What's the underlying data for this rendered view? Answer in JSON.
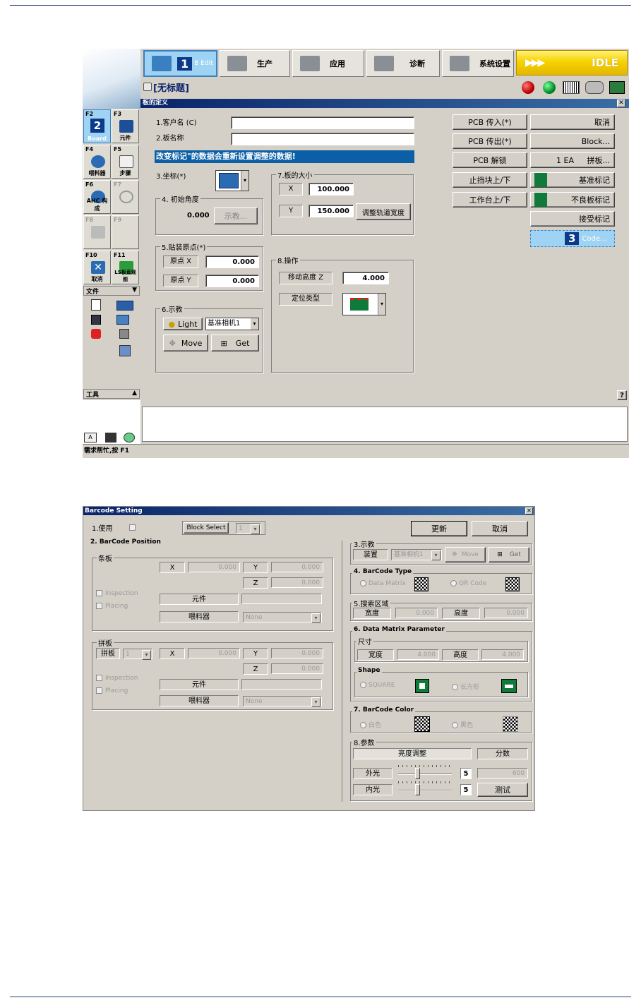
{
  "win1": {
    "toolbar": {
      "bedit_num": "1",
      "bedit_label": "B Edit",
      "items": [
        {
          "label": "生产"
        },
        {
          "label": "应用"
        },
        {
          "label": "诊断"
        },
        {
          "label": "系统设置"
        }
      ],
      "idle_arrows": "▶▶▶",
      "idle_label": "IDLE"
    },
    "doc_title": "[无标题]",
    "status_icons": [
      "red-lamp",
      "green-lamp",
      "barcode",
      "camera",
      "board"
    ],
    "fkeys": [
      {
        "key": "F2",
        "num": "2",
        "label": "Board"
      },
      {
        "key": "F3",
        "label": "元件"
      },
      {
        "key": "F4",
        "label": "喂料器"
      },
      {
        "key": "F5",
        "label": "步骤"
      },
      {
        "key": "F6",
        "label": "AHC 构成"
      },
      {
        "key": "F7",
        "label": ""
      },
      {
        "key": "F8",
        "label": ""
      },
      {
        "key": "F9",
        "label": ""
      },
      {
        "key": "F10",
        "label": "取消"
      },
      {
        "key": "F11",
        "label": "LS板直观图"
      }
    ],
    "file_header": "文件",
    "tools_header": "工具",
    "panel_title": "板的定义",
    "customer_label": "1.客户名 (C)",
    "board_name_label": "2.板名称",
    "customer_value": "",
    "board_name_value": "",
    "notice": "改变标记\"的数据会重新设置调整的数据!",
    "coord_label": "3.坐标(*)",
    "init_angle": {
      "title": "4. 初始角度",
      "value": "0.000",
      "teach": "示教..."
    },
    "board_size": {
      "title": "7.板的大小",
      "x_label": "X",
      "x_value": "100.000",
      "y_label": "Y",
      "y_value": "150.000",
      "adjust": "调整轨道宽度"
    },
    "origin": {
      "title": "5.贴装原点(*)",
      "x_label": "原点 X",
      "x_value": "0.000",
      "y_label": "原点 Y",
      "y_value": "0.000"
    },
    "op": {
      "title": "8.操作",
      "z_label": "移动高度 Z",
      "z_value": "4.000",
      "pos_label": "定位类型"
    },
    "teach": {
      "title": "6.示教",
      "light": "Light",
      "camera": "基准相机1",
      "move": "Move",
      "get": "Get"
    },
    "right_btns": {
      "pcb_in": "PCB 传入(*)",
      "cancel": "取消",
      "pcb_out": "PCB 传出(*)",
      "block": "Block...",
      "pcb_unlock": "PCB 解锁",
      "ea": "1 EA",
      "panel": "拼板...",
      "stopper": "止挡块上/下",
      "fiducial": "基准标记",
      "table": "工作台上/下",
      "bad_mark": "不良板标记",
      "accept": "接受标记",
      "code_num": "3",
      "code": "Code..."
    },
    "help_q": "?",
    "status_bar": "需求帮忙,按 F1"
  },
  "win2": {
    "title": "Barcode Setting",
    "use_label": "1.使用",
    "block_select": "Block Select",
    "block_value": "1",
    "update": "更新",
    "cancel": "取消",
    "pos_title": "2. BarCode Position",
    "strip": {
      "title": "条板",
      "x": "X",
      "x_value": "0.000",
      "y": "Y",
      "y_value": "0.000",
      "z": "Z",
      "z_value": "0.000",
      "inspection": "Inspection",
      "placing": "Placing",
      "part": "元件",
      "nozzle": "喂料器",
      "none": "None"
    },
    "panel": {
      "title": "拼板",
      "label": "拼板",
      "num": "1",
      "x": "X",
      "x_value": "0.000",
      "y": "Y",
      "y_value": "0.000",
      "z": "Z",
      "z_value": "0.000",
      "inspection": "Inspection",
      "placing": "Placing",
      "part": "元件",
      "nozzle": "喂料器",
      "none": "None"
    },
    "teach": {
      "title": "3.示教",
      "device": "装置",
      "camera": "基准相机1",
      "move": "Move",
      "get": "Get"
    },
    "type": {
      "title": "4. BarCode Type",
      "dm": "Data Matrix",
      "qr": "QR Code"
    },
    "search": {
      "title": "5.搜索区域",
      "w": "宽度",
      "w_value": "0.000",
      "h": "高度",
      "h_value": "0.000"
    },
    "dm_param": {
      "title": "6. Data Matrix Parameter",
      "size": "尺寸",
      "w": "宽度",
      "w_value": "4.000",
      "h": "高度",
      "h_value": "4.000",
      "shape": "Shape",
      "square": "SQUARE",
      "rect": "长方形"
    },
    "color": {
      "title": "7. BarCode Color",
      "white": "白色",
      "black": "黑色"
    },
    "param": {
      "title": "8.参数",
      "bright": "亮度调整",
      "score": "分数",
      "outer": "外光",
      "outer_value": "5",
      "inner": "内光",
      "inner_value": "5",
      "score_value": "600",
      "test": "测试"
    }
  },
  "colors": {
    "rule": "#1f3f73",
    "idle": "#f6d200",
    "titlebar": "#0a246a",
    "notice": "#0b5fa6",
    "green": "#107a3a"
  }
}
